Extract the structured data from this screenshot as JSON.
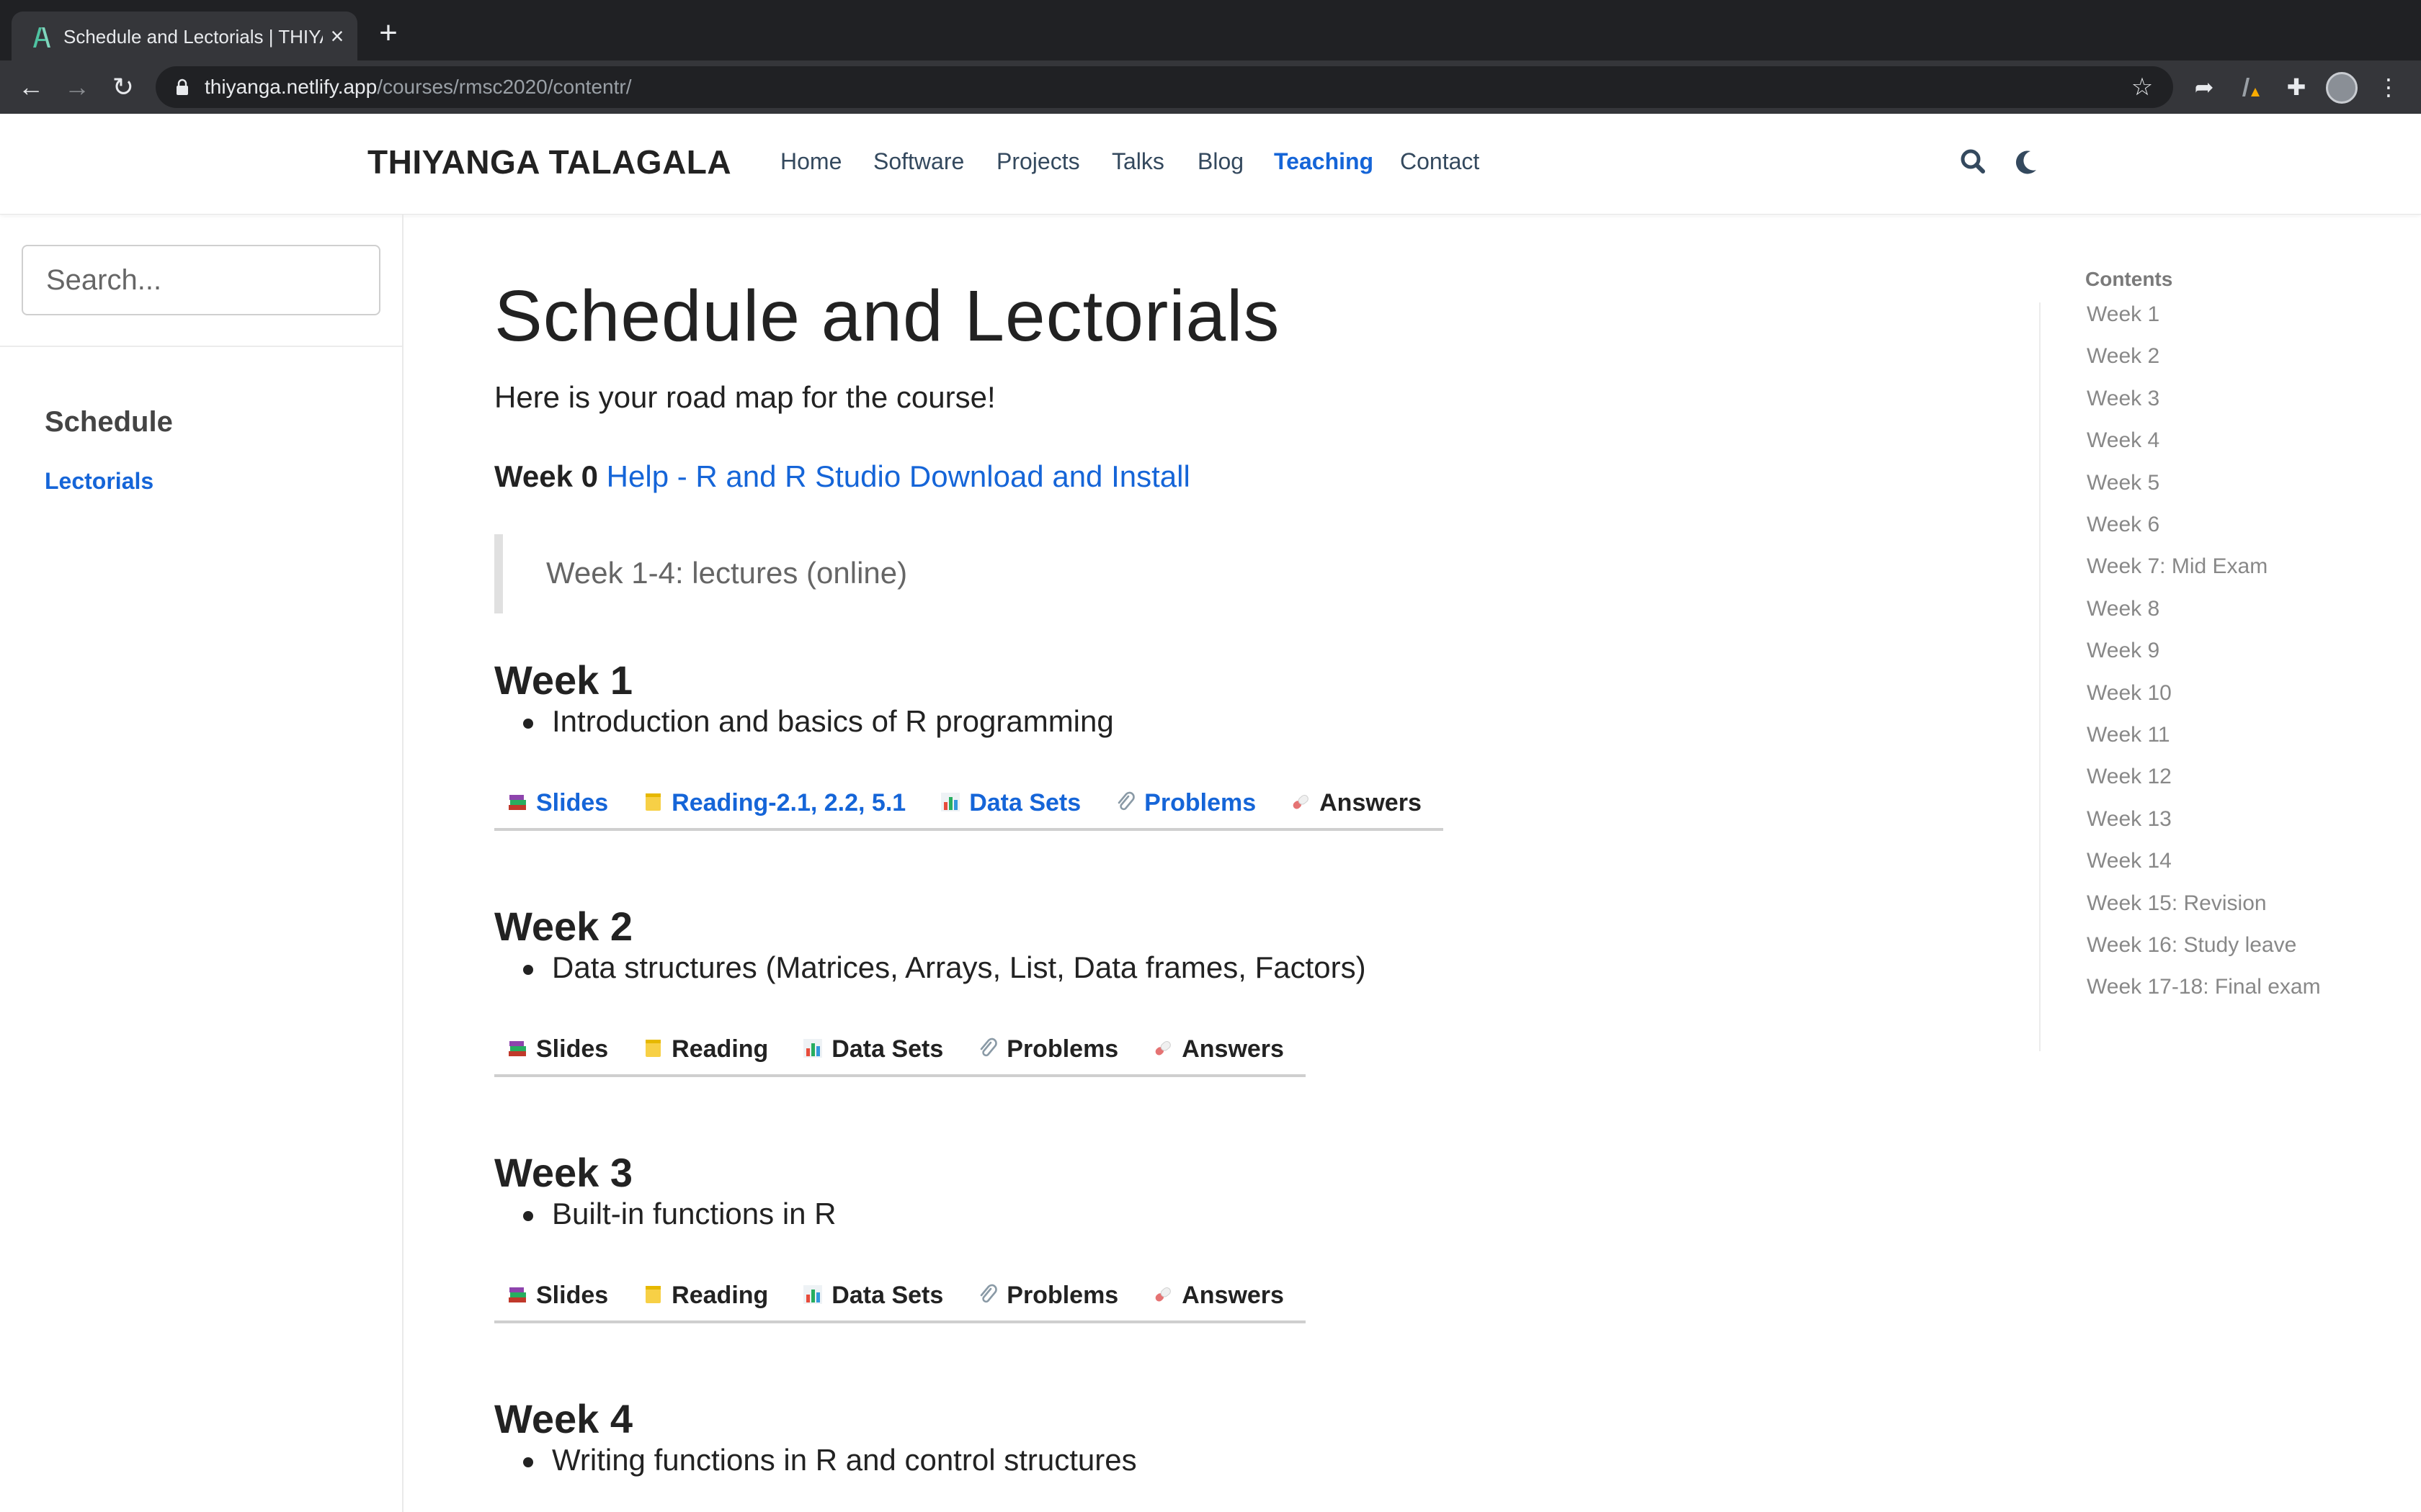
{
  "browser": {
    "tab_title": "Schedule and Lectorials | THIYANGA TALAGALA",
    "url_host": "thiyanga.netlify.app",
    "url_path": "/courses/rmsc2020/contentr/"
  },
  "site": {
    "brand": "THIYANGA TALAGALA",
    "nav": [
      "Home",
      "Software",
      "Projects",
      "Talks",
      "Blog",
      "Teaching",
      "Contact"
    ],
    "active_nav": "Teaching"
  },
  "sidebar": {
    "search_placeholder": "Search...",
    "heading": "Schedule",
    "item": "Lectorials"
  },
  "main": {
    "title": "Schedule and Lectorials",
    "intro": "Here is your road map for the course!",
    "week0_label": "Week 0",
    "week0_link": "Help - R and R Studio Download and Install",
    "quote": "Week 1-4: lectures (online)",
    "weeks": [
      {
        "title": "Week 1",
        "desc": "Introduction and basics of R programming",
        "resources": [
          {
            "icon": "books-icon",
            "label": "Slides",
            "link": true
          },
          {
            "icon": "notepad-icon",
            "label": "Reading-2.1, 2.2, 5.1",
            "link": true
          },
          {
            "icon": "bar-chart-icon",
            "label": "Data Sets",
            "link": true
          },
          {
            "icon": "paperclip-icon",
            "label": "Problems",
            "link": true
          },
          {
            "icon": "pill-icon",
            "label": "Answers",
            "link": false
          }
        ]
      },
      {
        "title": "Week 2",
        "desc": "Data structures (Matrices, Arrays, List, Data frames, Factors)",
        "resources": [
          {
            "icon": "books-icon",
            "label": "Slides",
            "link": false
          },
          {
            "icon": "notepad-icon",
            "label": "Reading",
            "link": false
          },
          {
            "icon": "bar-chart-icon",
            "label": "Data Sets",
            "link": false
          },
          {
            "icon": "paperclip-icon",
            "label": "Problems",
            "link": false
          },
          {
            "icon": "pill-icon",
            "label": "Answers",
            "link": false
          }
        ]
      },
      {
        "title": "Week 3",
        "desc": "Built-in functions in R",
        "resources": [
          {
            "icon": "books-icon",
            "label": "Slides",
            "link": false
          },
          {
            "icon": "notepad-icon",
            "label": "Reading",
            "link": false
          },
          {
            "icon": "bar-chart-icon",
            "label": "Data Sets",
            "link": false
          },
          {
            "icon": "paperclip-icon",
            "label": "Problems",
            "link": false
          },
          {
            "icon": "pill-icon",
            "label": "Answers",
            "link": false
          }
        ]
      },
      {
        "title": "Week 4",
        "desc": "Writing functions in R and control structures",
        "resources": []
      }
    ]
  },
  "toc": {
    "heading": "Contents",
    "items": [
      "Week 1",
      "Week 2",
      "Week 3",
      "Week 4",
      "Week 5",
      "Week 6",
      "Week 7: Mid Exam",
      "Week 8",
      "Week 9",
      "Week 10",
      "Week 11",
      "Week 12",
      "Week 13",
      "Week 14",
      "Week 15: Revision",
      "Week 16: Study leave",
      "Week 17-18: Final exam"
    ]
  },
  "colors": {
    "link": "#1565d8",
    "chrome_dark": "#202124",
    "chrome_mid": "#35363a"
  }
}
